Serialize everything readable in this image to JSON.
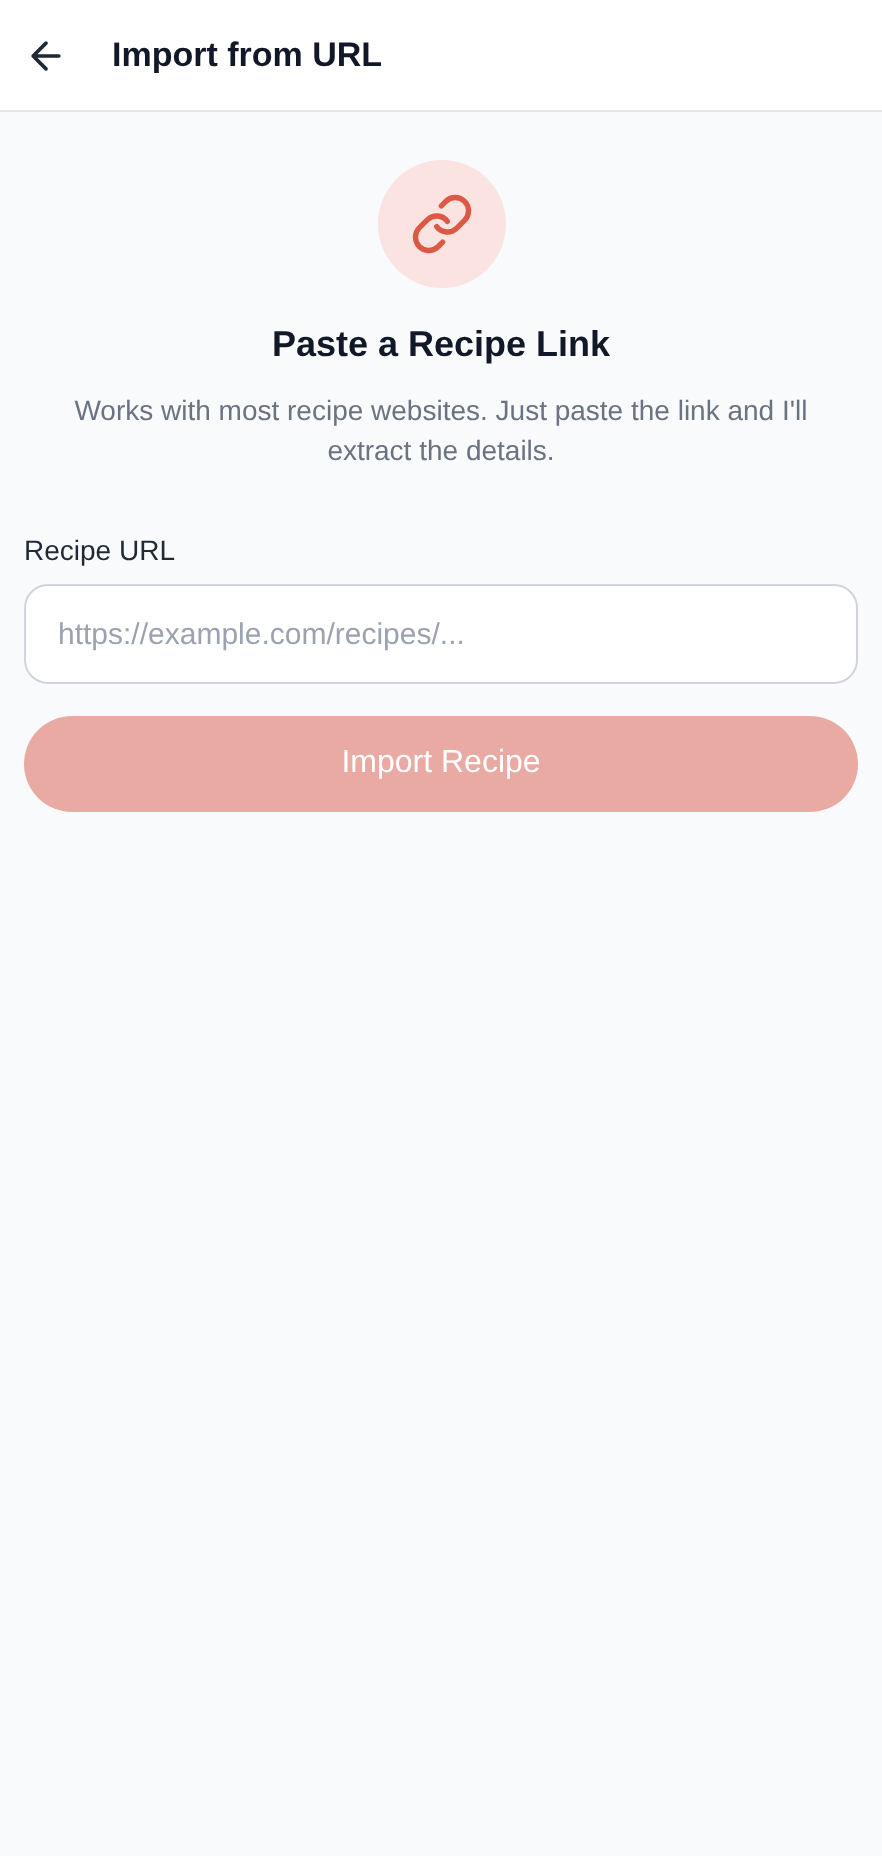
{
  "header": {
    "title": "Import from URL"
  },
  "intro": {
    "title": "Paste a Recipe Link",
    "description": "Works with most recipe websites. Just paste the link and I'll extract the details."
  },
  "url_field": {
    "label": "Recipe URL",
    "placeholder": "https://example.com/recipes/..."
  },
  "import_button": {
    "label": "Import Recipe",
    "disabled": true
  }
}
